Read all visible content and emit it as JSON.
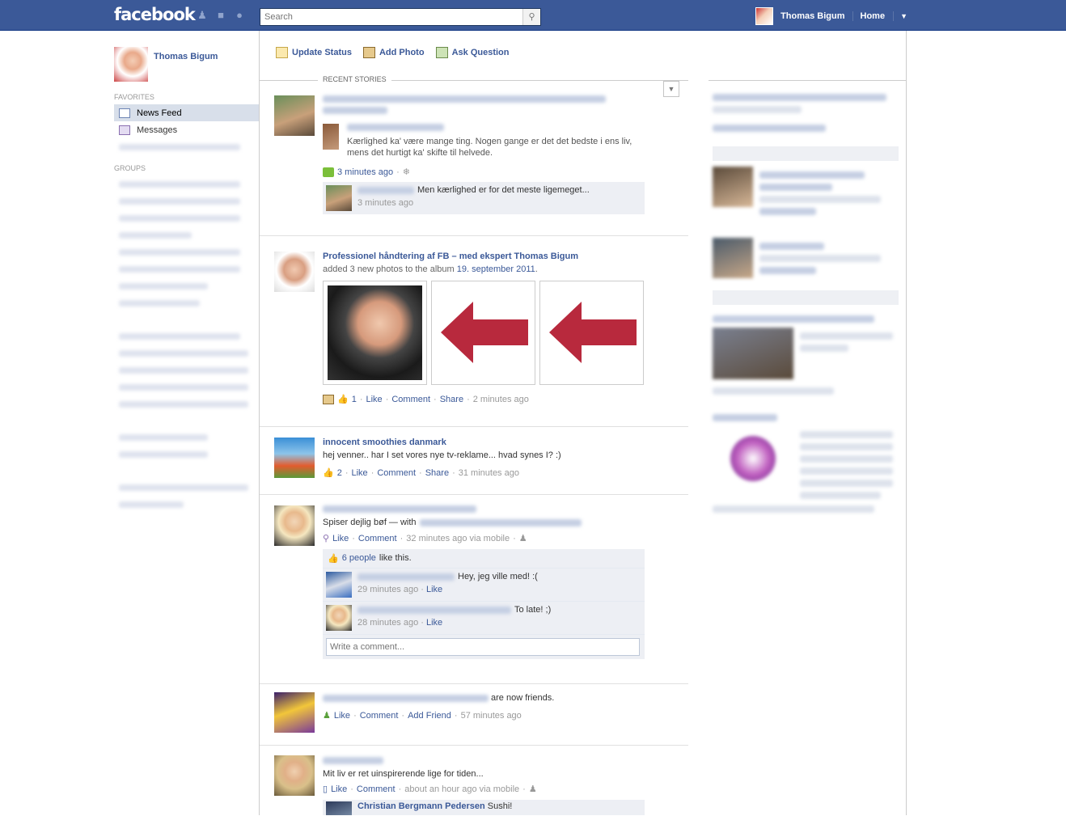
{
  "topbar": {
    "logo": "facebook",
    "search_placeholder": "Search",
    "user_name": "Thomas Bigum",
    "home_label": "Home"
  },
  "left": {
    "profile_name": "Thomas Bigum",
    "favorites_title": "FAVORITES",
    "favorites": [
      "News Feed",
      "Messages"
    ],
    "groups_title": "GROUPS"
  },
  "composer": {
    "update_status": "Update Status",
    "add_photo": "Add Photo",
    "ask_question": "Ask Question"
  },
  "feed": {
    "recent_stories": "RECENT STORIES",
    "story1": {
      "text": "Kærlighed ka' være mange ting. Nogen gange er det det bedste i ens liv, mens det hurtigt ka' skifte til helvede.",
      "time": "3 minutes ago",
      "comment_text": "Men kærlighed er for det meste ligemeget...",
      "comment_time": "3 minutes ago"
    },
    "story2": {
      "actor": "Professionel håndtering af FB – med ekspert Thomas Bigum",
      "action": "added 3 new photos to the album",
      "album": "19. september 2011",
      "likes": "1",
      "like": "Like",
      "comment": "Comment",
      "share": "Share",
      "time": "2 minutes ago"
    },
    "story3": {
      "actor": "innocent smoothies danmark",
      "text": "hej venner.. har I set vores nye tv-reklame... hvad synes I? :)",
      "likes": "2",
      "like": "Like",
      "comment": "Comment",
      "share": "Share",
      "time": "31 minutes ago"
    },
    "story4": {
      "text": "Spiser dejlig bøf — with",
      "like": "Like",
      "comment": "Comment",
      "time": "32 minutes ago via mobile",
      "likes_count": "6 people",
      "likes_suffix": "like this.",
      "c1_text": "Hey, jeg ville med! :(",
      "c1_time": "29 minutes ago",
      "c2_text": "To late! ;)",
      "c2_time": "28 minutes ago",
      "write_placeholder": "Write a comment..."
    },
    "story5": {
      "text": "are now friends.",
      "like": "Like",
      "comment": "Comment",
      "add_friend": "Add Friend",
      "time": "57 minutes ago"
    },
    "story6": {
      "text": "Mit liv er ret uinspirerende lige for tiden...",
      "like": "Like",
      "comment": "Comment",
      "time": "about an hour ago via mobile",
      "c1_author": "Christian Bergmann Pedersen",
      "c1_text": "Sushi!"
    }
  },
  "icons": [
    "people-icon",
    "chat-icon",
    "globe-icon",
    "search-icon",
    "chevron-down-icon",
    "like-icon",
    "photo-icon"
  ],
  "colors": {
    "brand": "#3b5998",
    "ufi_bg": "#edeff4",
    "arrow_red": "#b8293d"
  }
}
